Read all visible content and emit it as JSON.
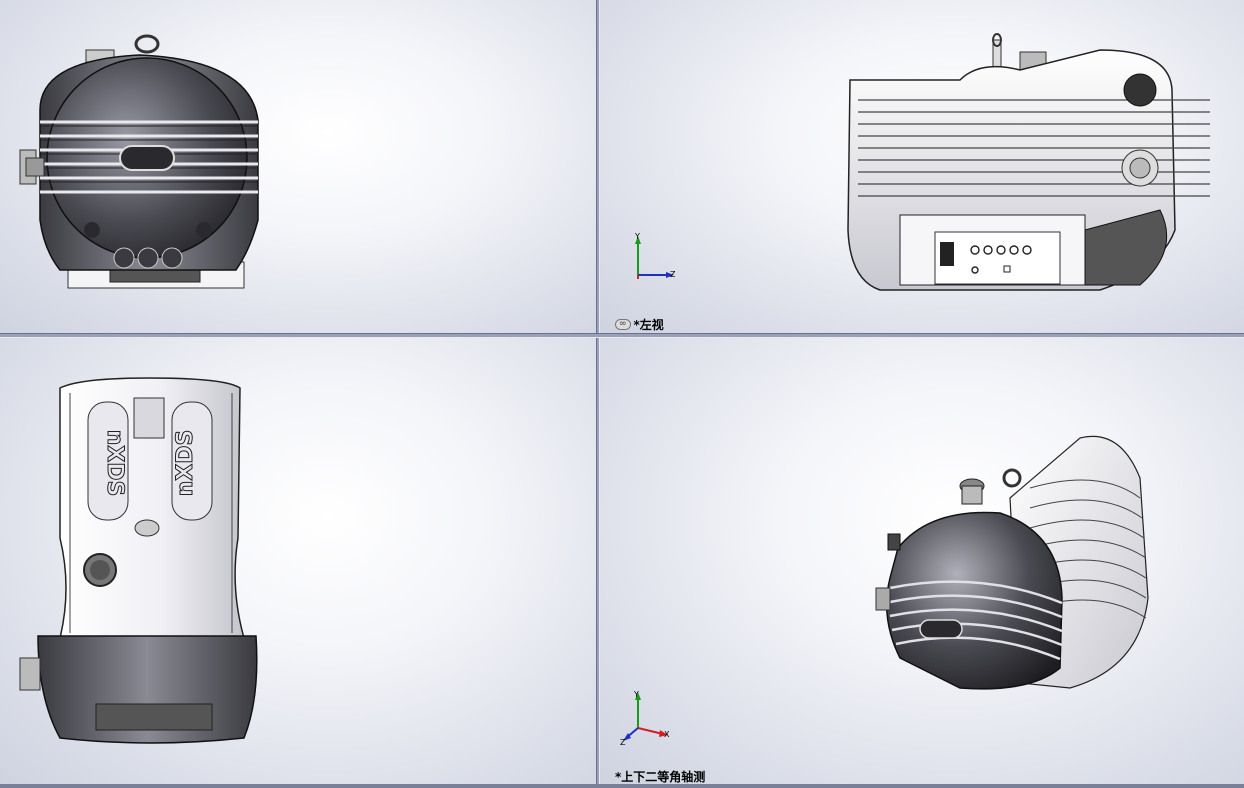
{
  "viewports": [
    {
      "id": "front",
      "label": ""
    },
    {
      "id": "left",
      "label": "*左视",
      "linked_icon": "link-icon"
    },
    {
      "id": "top",
      "label": ""
    },
    {
      "id": "iso",
      "label": "*上下二等角轴测"
    }
  ],
  "triad": {
    "left_view": {
      "x_axis": "Z",
      "y_axis": "Y"
    },
    "iso_view": {
      "x_axis": "X",
      "y_axis": "Y",
      "z_axis": "Z"
    }
  },
  "model": {
    "brand_text": "nXDS"
  },
  "colors": {
    "background_light": "#ffffff",
    "background_dark": "#cfd3e0",
    "splitter": "#9aa0b8",
    "axis_x": "#d02020",
    "axis_y": "#1a9a1a",
    "axis_z": "#2030c0"
  }
}
